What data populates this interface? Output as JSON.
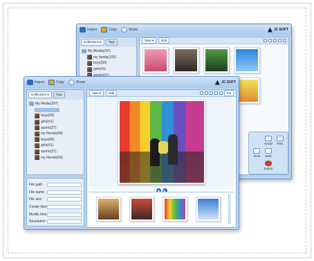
{
  "toolbar": {
    "import": "Import",
    "copy": "Copy",
    "share": "Share",
    "brand": "JC SOFT"
  },
  "sidebar": {
    "tab_collections": "Collections ▾",
    "tab_tags": "Tags",
    "root_back": "My Media(297)",
    "root_front": "My Media(297)",
    "items_back": [
      {
        "label": "my family(100)"
      },
      {
        "label": "boys(50)"
      },
      {
        "label": "girls(41)"
      },
      {
        "label": "sports(37)"
      }
    ],
    "items_front": [
      {
        "label": ""
      },
      {
        "label": "boys(60)"
      },
      {
        "label": "girls(41)"
      },
      {
        "label": "sports(37)"
      },
      {
        "label": "my friends(59)"
      },
      {
        "label": "boys(60)"
      },
      {
        "label": "girls(41)"
      },
      {
        "label": "sports(37)"
      },
      {
        "label": "my friends(59)"
      }
    ]
  },
  "main": {
    "view_button": "View ▾",
    "edit_button": "Edit",
    "fix_button": "Fix"
  },
  "properties": {
    "file_path": "File path",
    "file_name": "File name",
    "file_size": "File size",
    "create_time": "Create time",
    "modify_time": "Modify time",
    "resolution": "Resolution"
  },
  "actions": {
    "email": "Email",
    "print": "Print",
    "dvd": "DVD",
    "web": "Web",
    "export": "Export"
  },
  "colors": {
    "accent": "#5f8fc9",
    "panel": "#b9d4ef",
    "selection": "#9cbfe6"
  }
}
